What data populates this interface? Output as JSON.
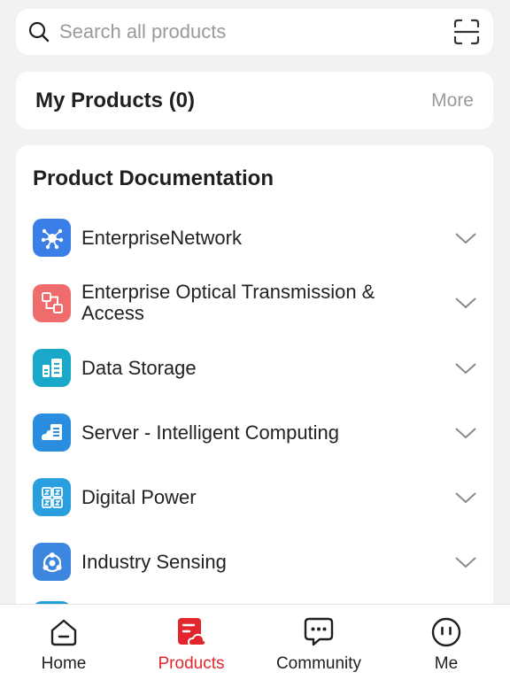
{
  "search": {
    "placeholder": "Search all products",
    "icon": "search-icon",
    "scan_icon": "scan-icon"
  },
  "my_products": {
    "title": "My Products (0)",
    "more_label": "More"
  },
  "documentation": {
    "title": "Product Documentation",
    "items": [
      {
        "label": "EnterpriseNetwork",
        "icon": "network-icon",
        "color": "#3a7ee8"
      },
      {
        "label": "Enterprise Optical Transmission & Access",
        "icon": "optical-transmission-icon",
        "color": "#f06b6b"
      },
      {
        "label": "Data Storage",
        "icon": "data-storage-icon",
        "color": "#19a8c9"
      },
      {
        "label": "Server - Intelligent Computing",
        "icon": "server-icon",
        "color": "#2a8ee0"
      },
      {
        "label": "Digital Power",
        "icon": "digital-power-icon",
        "color": "#2a9fe0"
      },
      {
        "label": "Industry Sensing",
        "icon": "industry-sensing-icon",
        "color": "#3d86e0"
      }
    ]
  },
  "bottom_nav": [
    {
      "label": "Home",
      "icon": "home-icon",
      "active": false
    },
    {
      "label": "Products",
      "icon": "products-icon",
      "active": true
    },
    {
      "label": "Community",
      "icon": "community-icon",
      "active": false
    },
    {
      "label": "Me",
      "icon": "me-icon",
      "active": false
    }
  ],
  "colors": {
    "accent": "#e3262d",
    "background": "#f2f2f4",
    "card": "#ffffff",
    "muted_text": "#9a9a9e"
  }
}
